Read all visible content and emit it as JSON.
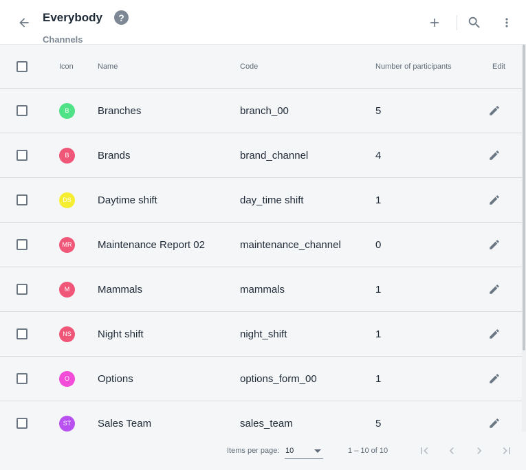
{
  "header": {
    "title": "Everybody",
    "subtitle": "Channels",
    "help_glyph": "?",
    "back_icon": "arrow-back-icon",
    "add_icon": "plus-icon",
    "search_icon": "search-icon",
    "more_icon": "more-vert-icon"
  },
  "table": {
    "columns": {
      "icon": "Icon",
      "name": "Name",
      "code": "Code",
      "participants": "Number of participants",
      "edit": "Edit"
    },
    "rows": [
      {
        "initials": "B",
        "color": "#3fe07a",
        "name": "Branches",
        "code": "branch_00",
        "participants": "5"
      },
      {
        "initials": "B",
        "color": "#f0456b",
        "name": "Brands",
        "code": "brand_channel",
        "participants": "4"
      },
      {
        "initials": "DS",
        "color": "#f6ee1b",
        "name": "Daytime shift",
        "code": "day_time shift",
        "participants": "1"
      },
      {
        "initials": "MR",
        "color": "#f0456b",
        "name": "Maintenance Report 02",
        "code": "maintenance_channel",
        "participants": "0"
      },
      {
        "initials": "M",
        "color": "#f0456b",
        "name": "Mammals",
        "code": "mammals",
        "participants": "1"
      },
      {
        "initials": "NS",
        "color": "#f0456b",
        "name": "Night shift",
        "code": "night_shift",
        "participants": "1"
      },
      {
        "initials": "O",
        "color": "#f33ad6",
        "name": "Options",
        "code": "options_form_00",
        "participants": "1"
      },
      {
        "initials": "ST",
        "color": "#b33ff0",
        "name": "Sales Team",
        "code": "sales_team",
        "participants": "5"
      }
    ]
  },
  "paginator": {
    "items_per_page_label": "Items per page:",
    "items_per_page_value": "10",
    "range": "1 – 10 of 10",
    "first_icon": "first-page-icon",
    "prev_icon": "chevron-left-icon",
    "next_icon": "chevron-right-icon",
    "last_icon": "last-page-icon"
  }
}
